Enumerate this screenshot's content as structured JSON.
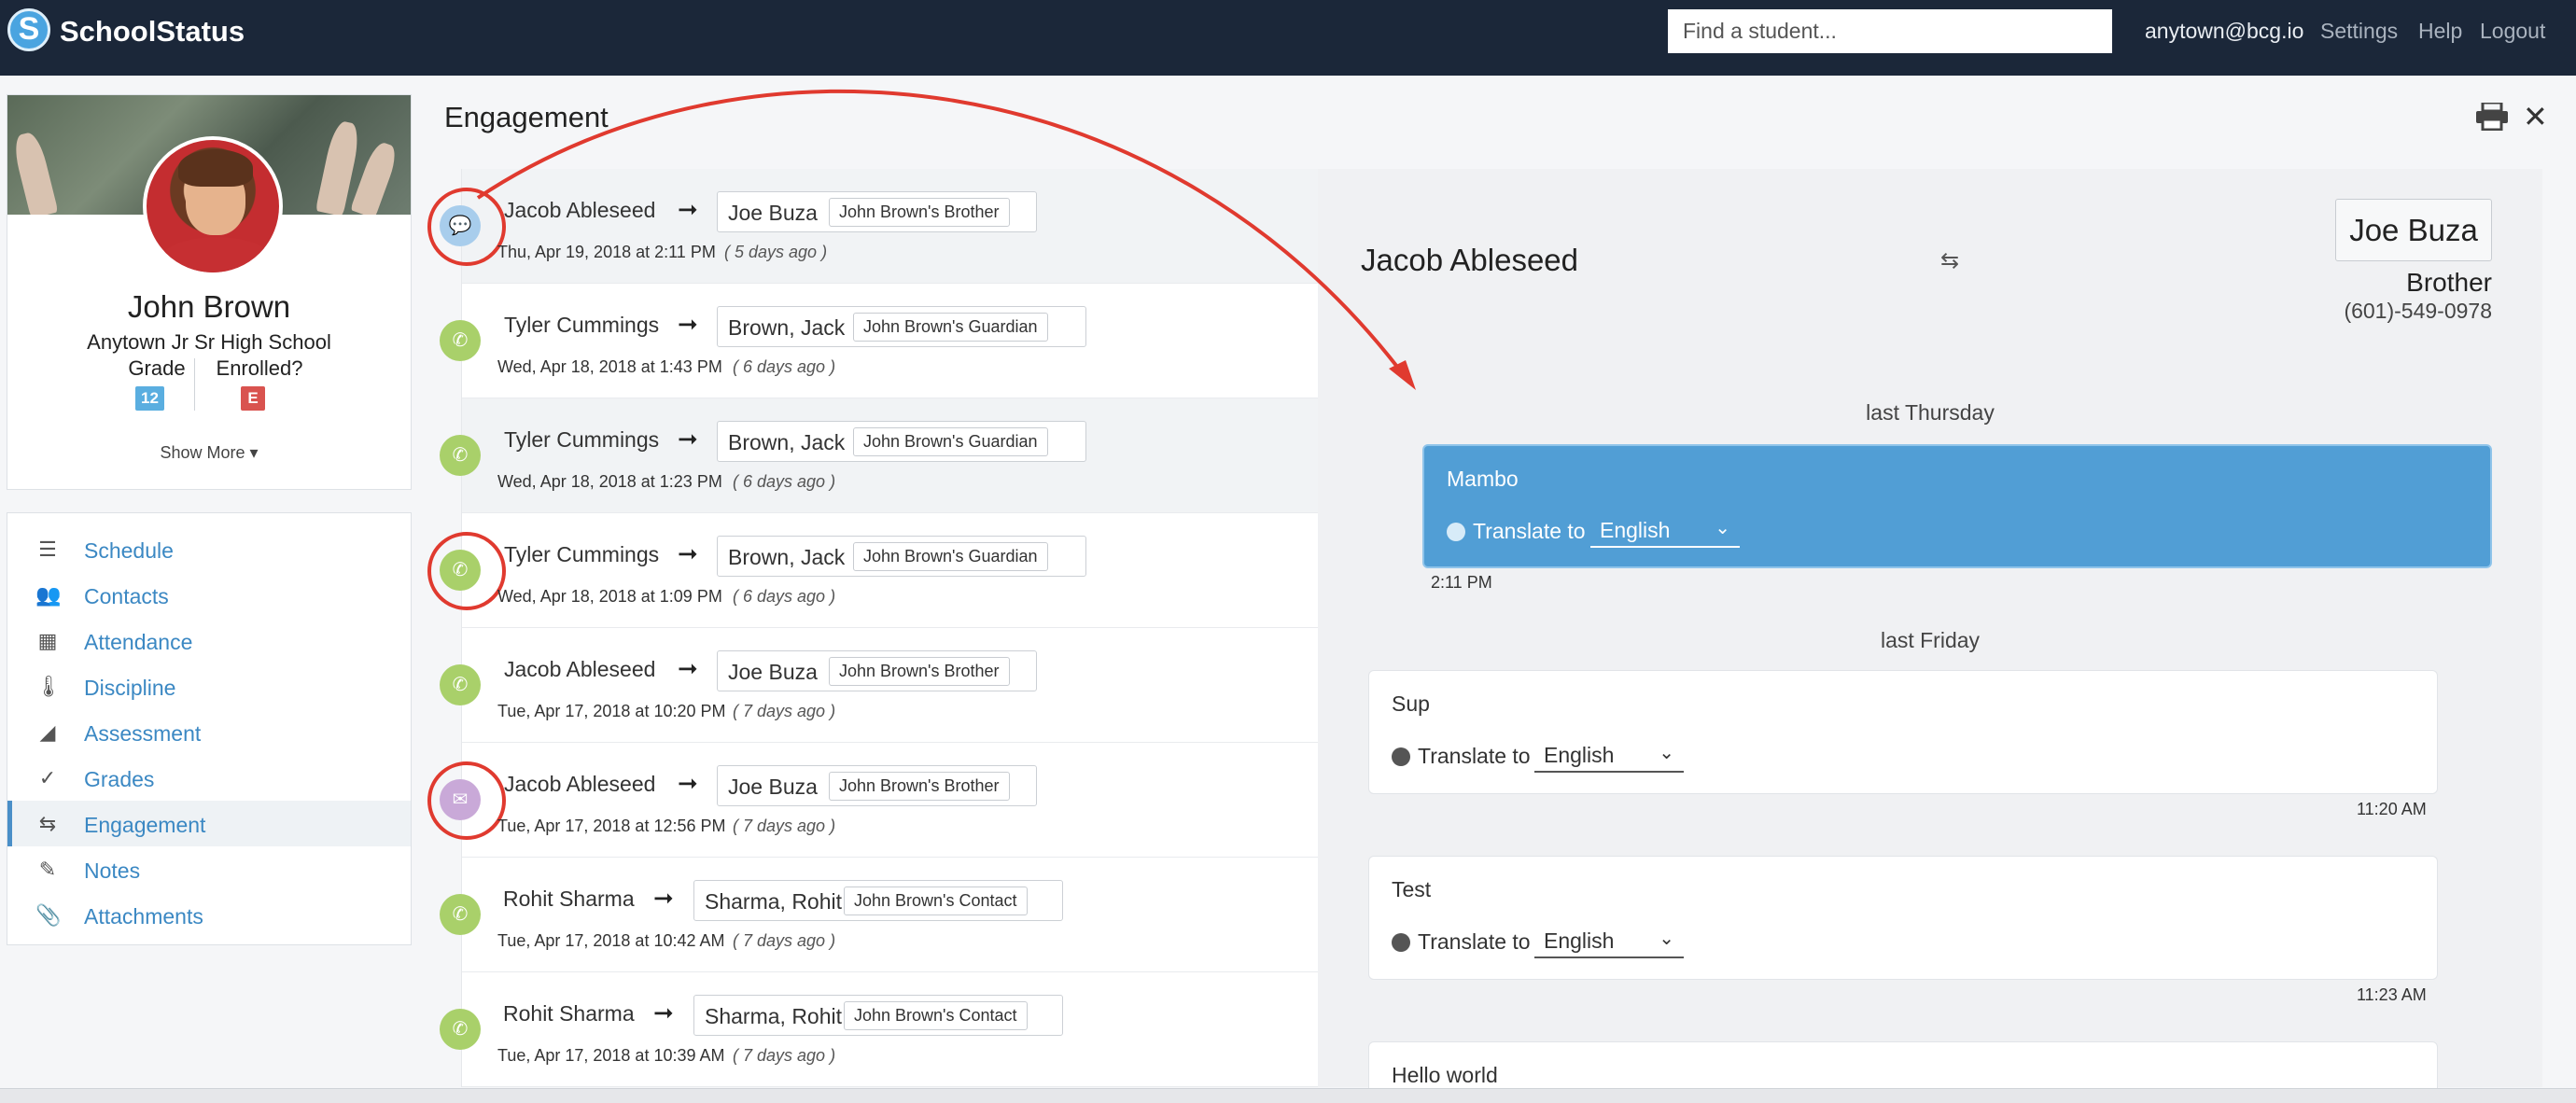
{
  "app": {
    "brand": "SchoolStatus",
    "logo_letter": "S"
  },
  "topbar": {
    "search_placeholder": "Find a student...",
    "user": "anytown@bcg.io",
    "settings": "Settings",
    "help": "Help",
    "logout": "Logout"
  },
  "profile": {
    "name": "John Brown",
    "school": "Anytown Jr Sr High School",
    "grade_label": "Grade",
    "grade_value": "12",
    "enrolled_label": "Enrolled?",
    "enrolled_value": "E",
    "show_more": "Show More ▾"
  },
  "nav": [
    {
      "label": "Schedule",
      "icon": "list-icon"
    },
    {
      "label": "Contacts",
      "icon": "contacts-icon"
    },
    {
      "label": "Attendance",
      "icon": "calendar-icon"
    },
    {
      "label": "Discipline",
      "icon": "thermometer-icon"
    },
    {
      "label": "Assessment",
      "icon": "area-chart-icon"
    },
    {
      "label": "Grades",
      "icon": "check-icon"
    },
    {
      "label": "Engagement",
      "icon": "swap-icon",
      "active": true
    },
    {
      "label": "Notes",
      "icon": "pencil-icon"
    },
    {
      "label": "Attachments",
      "icon": "paperclip-icon"
    }
  ],
  "engagement": {
    "title": "Engagement",
    "rows": [
      {
        "from": "Jacob Ableseed",
        "to": "Joe Buza",
        "relation": "John Brown's Brother",
        "date": "Thu, Apr 19, 2018 at 2:11 PM",
        "ago": "( 5 days ago )",
        "type": "message"
      },
      {
        "from": "Tyler Cummings",
        "to": "Brown, Jack",
        "relation": "John Brown's Guardian",
        "date": "Wed, Apr 18, 2018 at 1:43 PM",
        "ago": "( 6 days ago )",
        "type": "call"
      },
      {
        "from": "Tyler Cummings",
        "to": "Brown, Jack",
        "relation": "John Brown's Guardian",
        "date": "Wed, Apr 18, 2018 at 1:23 PM",
        "ago": "( 6 days ago )",
        "type": "call"
      },
      {
        "from": "Tyler Cummings",
        "to": "Brown, Jack",
        "relation": "John Brown's Guardian",
        "date": "Wed, Apr 18, 2018 at 1:09 PM",
        "ago": "( 6 days ago )",
        "type": "call"
      },
      {
        "from": "Jacob Ableseed",
        "to": "Joe Buza",
        "relation": "John Brown's Brother",
        "date": "Tue, Apr 17, 2018 at 10:20 PM",
        "ago": "( 7 days ago )",
        "type": "call"
      },
      {
        "from": "Jacob Ableseed",
        "to": "Joe Buza",
        "relation": "John Brown's Brother",
        "date": "Tue, Apr 17, 2018 at 12:56 PM",
        "ago": "( 7 days ago )",
        "type": "email"
      },
      {
        "from": "Rohit Sharma",
        "to": "Sharma, Rohit",
        "relation": "John Brown's Contact",
        "date": "Tue, Apr 17, 2018 at 10:42 AM",
        "ago": "( 7 days ago )",
        "type": "call"
      },
      {
        "from": "Rohit Sharma",
        "to": "Sharma, Rohit",
        "relation": "John Brown's Contact",
        "date": "Tue, Apr 17, 2018 at 10:39 AM",
        "ago": "( 7 days ago )",
        "type": "call"
      }
    ]
  },
  "conversation": {
    "sender": "Jacob Ableseed",
    "contact_name": "Joe Buza",
    "contact_relation": "Brother",
    "contact_phone": "(601)-549-0978",
    "translate_label": "Translate to",
    "language": "English",
    "days": [
      {
        "label": "last Thursday"
      },
      {
        "label": "last Friday"
      }
    ],
    "messages": [
      {
        "text": "Mambo",
        "time": "2:11 PM",
        "direction": "sent"
      },
      {
        "text": "Sup",
        "time": "11:20 AM",
        "direction": "received"
      },
      {
        "text": "Test",
        "time": "11:23 AM",
        "direction": "received"
      },
      {
        "text": "Hello world",
        "time": "",
        "direction": "received"
      }
    ]
  },
  "colors": {
    "topbar": "#1b2739",
    "link": "#3b88c3",
    "call": "#a9d06a",
    "message": "#a8cdec",
    "email": "#c9a9d8",
    "sent_bubble": "#519ed5",
    "annotation": "#e03a2f"
  }
}
